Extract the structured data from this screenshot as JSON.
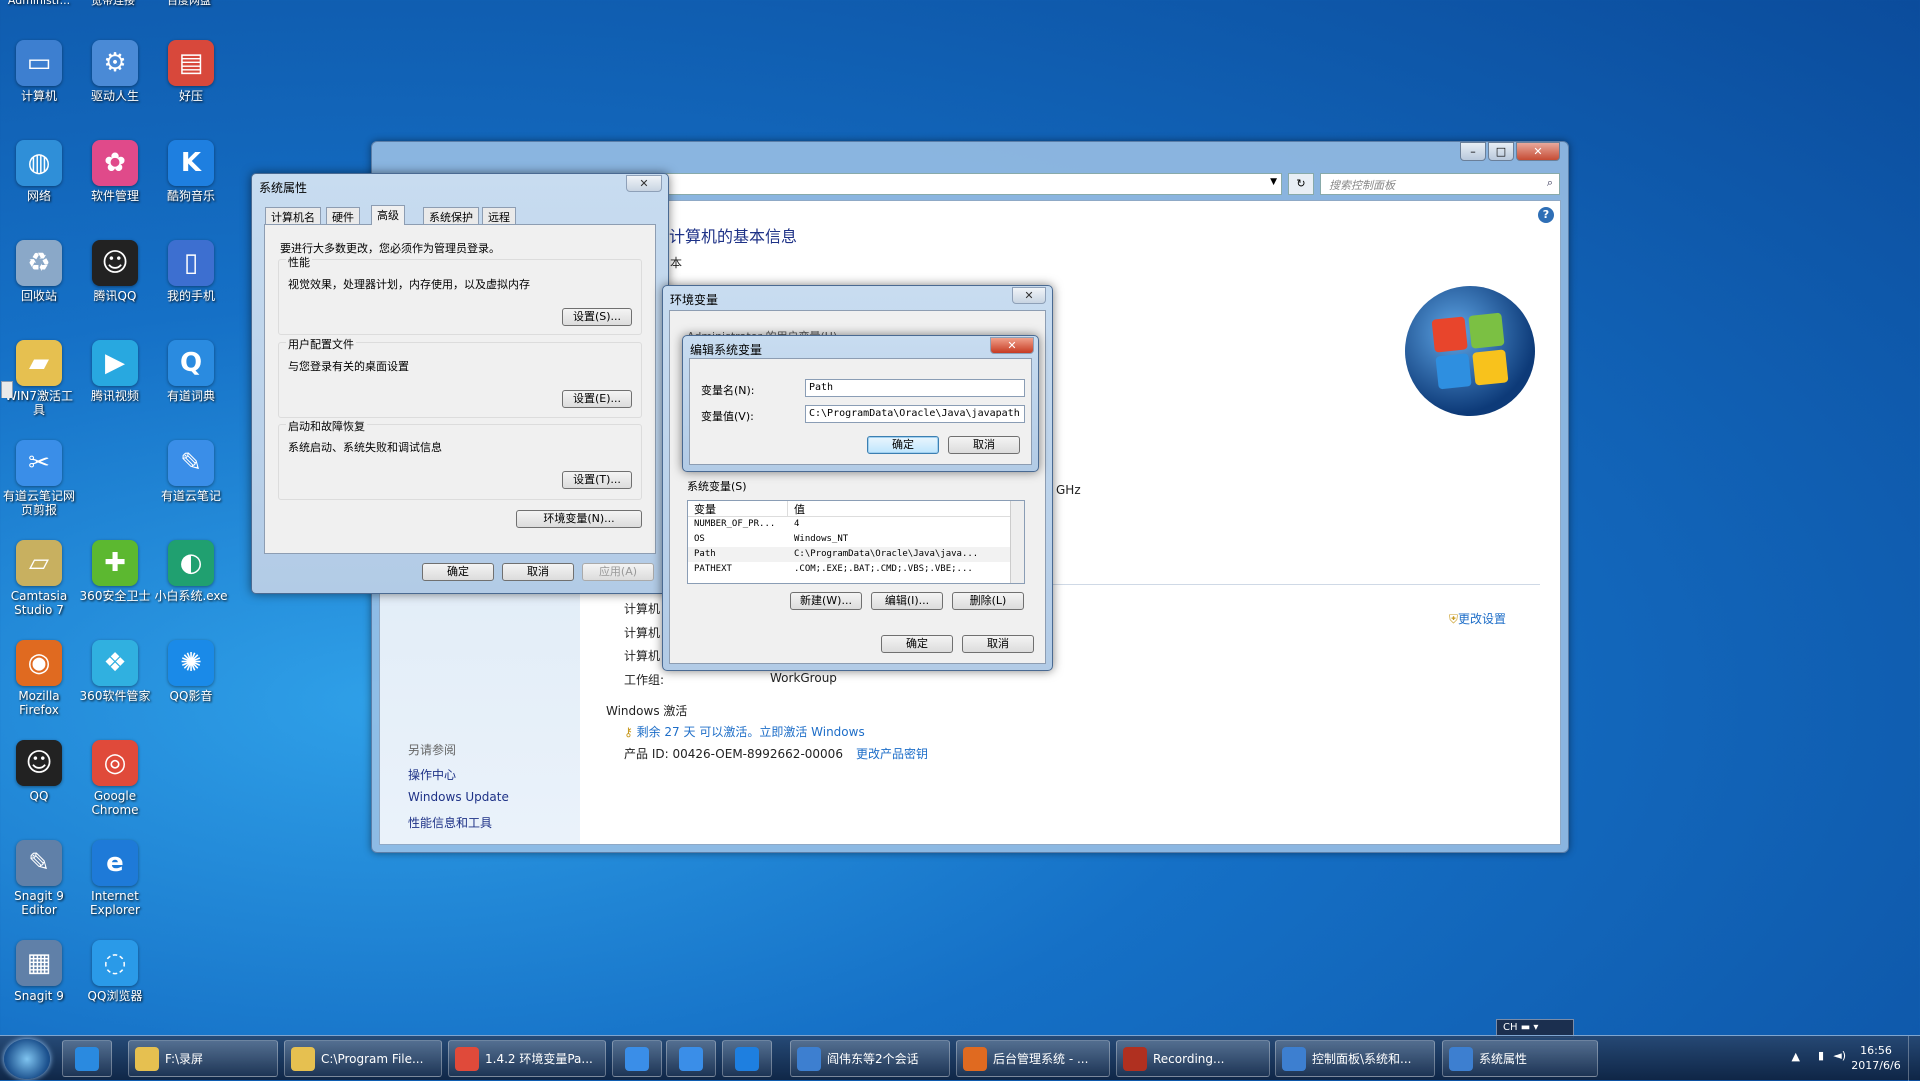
{
  "desktop": {
    "top_labels": [
      "Administr...",
      "宽带连接",
      "百度网盘"
    ],
    "icons": [
      {
        "label": "计算机",
        "color": "#3d7fd0",
        "glyph": "▭"
      },
      {
        "label": "驱动人生",
        "color": "#4a8ad6",
        "glyph": "⚙"
      },
      {
        "label": "好压",
        "color": "#d8483b",
        "glyph": "▤"
      },
      {
        "label": "网络",
        "color": "#2f8fd8",
        "glyph": "◍"
      },
      {
        "label": "软件管理",
        "color": "#e04a8a",
        "glyph": "✿"
      },
      {
        "label": "酷狗音乐",
        "color": "#1e7fe0",
        "glyph": "K"
      },
      {
        "label": "回收站",
        "color": "#8aa8c8",
        "glyph": "♻"
      },
      {
        "label": "腾讯QQ",
        "color": "#222222",
        "glyph": "☺"
      },
      {
        "label": "我的手机",
        "color": "#3d6fd0",
        "glyph": "▯"
      },
      {
        "label": "WIN7激活工具",
        "color": "#e6c050",
        "glyph": "▰"
      },
      {
        "label": "腾讯视频",
        "color": "#28a8e0",
        "glyph": "▶"
      },
      {
        "label": "有道词典",
        "color": "#2a8be0",
        "glyph": "Q"
      },
      {
        "label": "有道云笔记网页剪报",
        "color": "#3a8ee8",
        "glyph": "✂"
      },
      {
        "label": "",
        "color": "",
        "glyph": ""
      },
      {
        "label": "有道云笔记",
        "color": "#3a8ee8",
        "glyph": "✎"
      },
      {
        "label": "Camtasia Studio 7",
        "color": "#c8b060",
        "glyph": "▱"
      },
      {
        "label": "360安全卫士",
        "color": "#5cb830",
        "glyph": "✚"
      },
      {
        "label": "小白系统.exe",
        "color": "#20a070",
        "glyph": "◐"
      },
      {
        "label": "Mozilla Firefox",
        "color": "#e06a20",
        "glyph": "◉"
      },
      {
        "label": "360软件管家",
        "color": "#30b0e0",
        "glyph": "❖"
      },
      {
        "label": "QQ影音",
        "color": "#1a8ae8",
        "glyph": "✺"
      },
      {
        "label": "QQ",
        "color": "#222222",
        "glyph": "☺"
      },
      {
        "label": "Google Chrome",
        "color": "#e04a3a",
        "glyph": "◎"
      },
      {
        "label": "",
        "color": "",
        "glyph": ""
      },
      {
        "label": "Snagit 9 Editor",
        "color": "#6080a8",
        "glyph": "✎"
      },
      {
        "label": "Internet Explorer",
        "color": "#1e7ad8",
        "glyph": "e"
      },
      {
        "label": "",
        "color": "",
        "glyph": ""
      },
      {
        "label": "Snagit 9",
        "color": "#6080a8",
        "glyph": "▦"
      },
      {
        "label": "QQ浏览器",
        "color": "#2a9ae8",
        "glyph": "◌"
      }
    ]
  },
  "control_panel": {
    "search_placeholder": "搜索控制面板",
    "heading": "计算机的基本信息",
    "sub_fragment": "本",
    "cpu_fragment": "GHz",
    "change_settings": "更改设置",
    "computer_rows": [
      "计算机",
      "计算机",
      "计算机"
    ],
    "workgroup_label": "工作组:",
    "workgroup_value": "WorkGroup",
    "activation_heading": "Windows 激活",
    "activation_text": "剩余 27 天 可以激活。立即激活 Windows",
    "product_id": "产品 ID: 00426-OEM-8992662-00006",
    "change_key": "更改产品密钥",
    "see_also": "另请参阅",
    "side_links": [
      "操作中心",
      "Windows Update",
      "性能信息和工具"
    ]
  },
  "sysprops": {
    "title": "系统属性",
    "tabs": [
      "计算机名",
      "硬件",
      "高级",
      "系统保护",
      "远程"
    ],
    "admin_note": "要进行大多数更改，您必须作为管理员登录。",
    "perf_title": "性能",
    "perf_desc": "视觉效果，处理器计划，内存使用，以及虚拟内存",
    "perf_btn": "设置(S)...",
    "profile_title": "用户配置文件",
    "profile_desc": "与您登录有关的桌面设置",
    "profile_btn": "设置(E)...",
    "startup_title": "启动和故障恢复",
    "startup_desc": "系统启动、系统失败和调试信息",
    "startup_btn": "设置(T)...",
    "env_btn": "环境变量(N)...",
    "ok": "确定",
    "cancel": "取消",
    "apply": "应用(A)"
  },
  "envvars": {
    "title": "环境变量",
    "user_vars_fragment": "Administrator 的用户变量(U)",
    "sys_vars_title": "系统变量(S)",
    "col_var": "变量",
    "col_val": "值",
    "rows": [
      {
        "name": "NUMBER_OF_PR...",
        "value": "4"
      },
      {
        "name": "OS",
        "value": "Windows_NT"
      },
      {
        "name": "Path",
        "value": "C:\\ProgramData\\Oracle\\Java\\java..."
      },
      {
        "name": "PATHEXT",
        "value": ".COM;.EXE;.BAT;.CMD;.VBS;.VBE;..."
      }
    ],
    "new_btn": "新建(W)...",
    "edit_btn": "编辑(I)...",
    "delete_btn": "删除(L)",
    "ok": "确定",
    "cancel": "取消"
  },
  "editvar": {
    "title": "编辑系统变量",
    "name_label": "变量名(N):",
    "name_value": "Path",
    "value_label": "变量值(V):",
    "value_value": "C:\\ProgramData\\Oracle\\Java\\javapath",
    "ok": "确定",
    "cancel": "取消"
  },
  "taskbar": {
    "items": [
      {
        "label": "",
        "color": "#2a8ae0"
      },
      {
        "label": "F:\\录屏",
        "color": "#e6c050"
      },
      {
        "label": "C:\\Program File...",
        "color": "#e6c050"
      },
      {
        "label": "1.4.2 环境变量Pa...",
        "color": "#e04a3a"
      },
      {
        "label": "",
        "color": "#3a8ee8"
      },
      {
        "label": "",
        "color": "#3a8ee8"
      },
      {
        "label": "",
        "color": "#1e7fe0"
      },
      {
        "label": "阎伟东等2个会话",
        "color": "#3d7fd0"
      },
      {
        "label": "后台管理系统 - ...",
        "color": "#e06a20"
      },
      {
        "label": "Recording...",
        "color": "#b03020"
      },
      {
        "label": "控制面板\\系统和...",
        "color": "#3d7fd0"
      },
      {
        "label": "系统属性",
        "color": "#3d7fd0"
      }
    ],
    "ime": "CH",
    "time": "16:56",
    "date": "2017/6/6"
  }
}
